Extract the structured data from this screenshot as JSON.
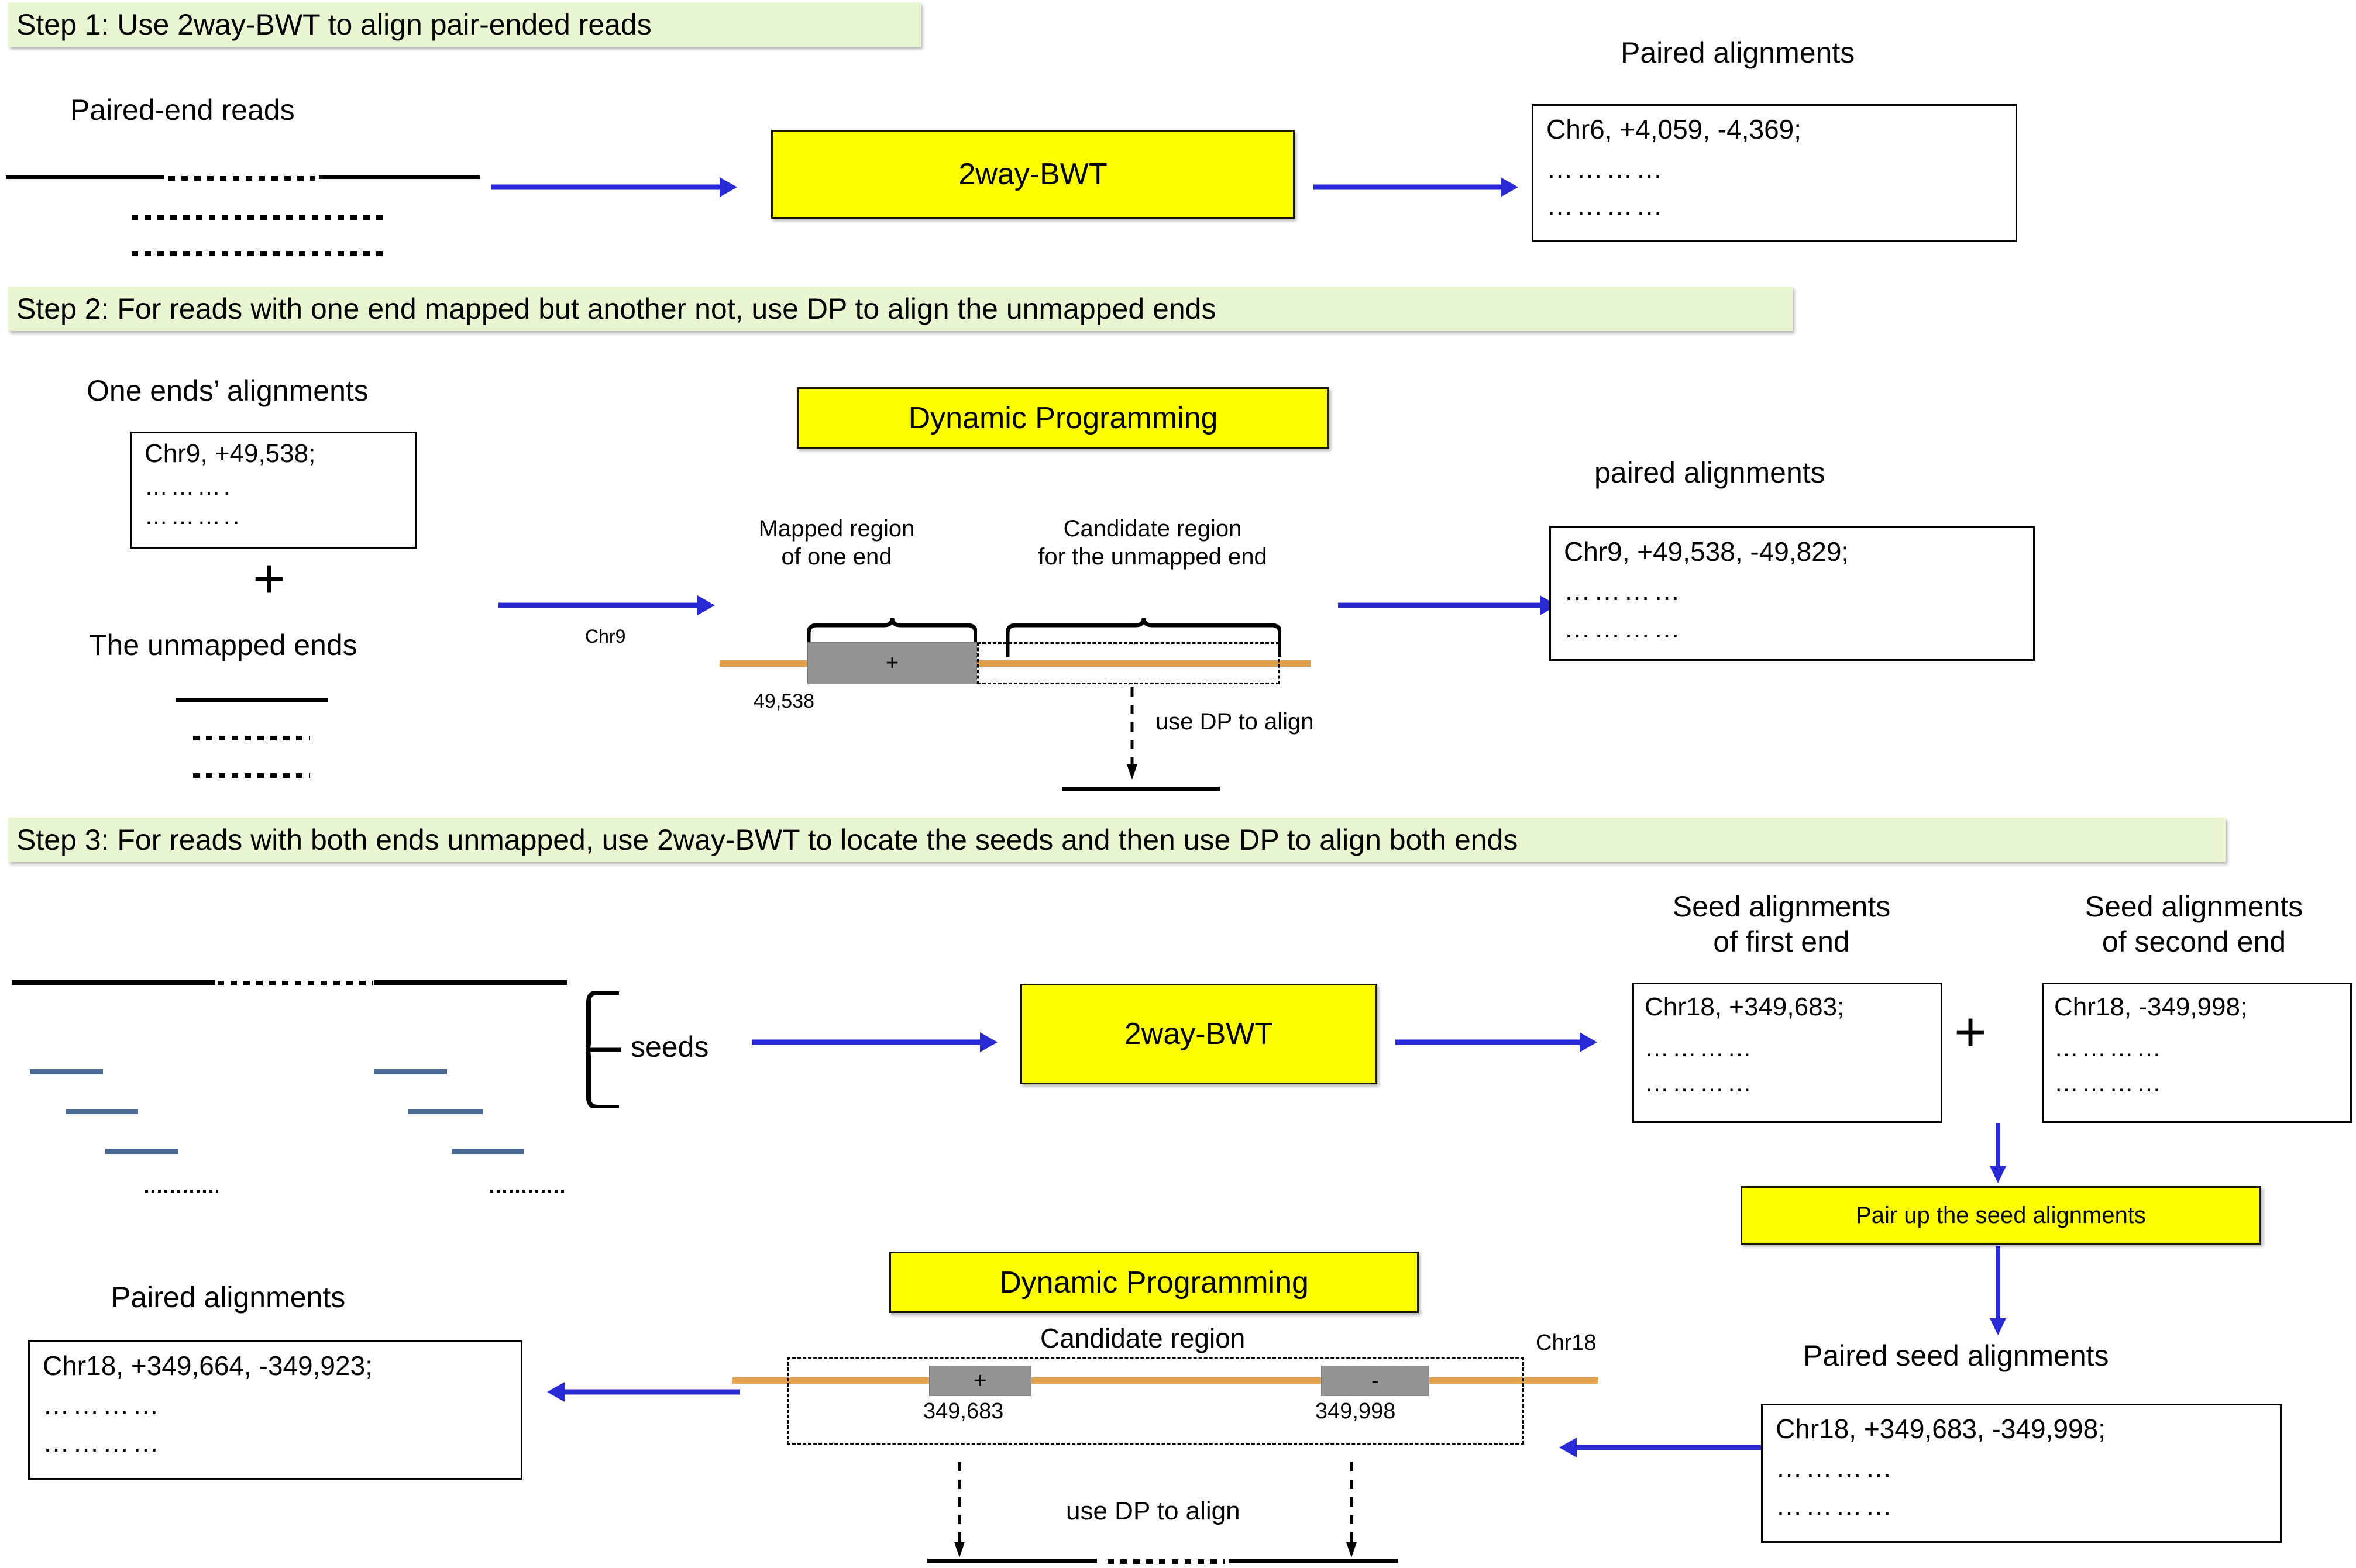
{
  "steps": {
    "step1": {
      "banner": "Step 1: Use 2way-BWT to align pair-ended reads",
      "input_label": "Paired-end reads",
      "process_label": "2way-BWT",
      "output_label": "Paired alignments",
      "output_box": {
        "line1": "Chr6, +4,059, -4,369;",
        "dots1": "…………",
        "dots2": "…………"
      }
    },
    "step2": {
      "banner": "Step 2: For reads with one end mapped but another not, use DP to align the unmapped ends",
      "input_label": "One ends’ alignments",
      "input_box": {
        "line1": "Chr9, +49,538;",
        "dots1": "……….",
        "dots2": "……….."
      },
      "plus": "+",
      "second_input_label": "The unmapped ends",
      "second_input_dots1": "……….",
      "second_input_dots2": "……….",
      "arrow_label": "Chr9",
      "process_label": "Dynamic Programming",
      "mapped_region_label": "Mapped region\nof one end",
      "candidate_region_label": "Candidate region\nfor the unmapped end",
      "mapped_block_sign": "+",
      "mapped_position": "49,538",
      "dp_note": "use DP to align",
      "output_label": "paired alignments",
      "output_box": {
        "line1": "Chr9, +49,538, -49,829;",
        "dots1": "…………",
        "dots2": "…………"
      }
    },
    "step3": {
      "banner": "Step 3: For reads with both ends unmapped, use 2way-BWT to locate the seeds and then use DP to align both ends",
      "seeds_label": "seeds",
      "process_label": "2way-BWT",
      "first_end_label": "Seed alignments\nof first end",
      "first_end_box": {
        "line1": "Chr18, +349,683;",
        "dots1": "…………",
        "dots2": "…………"
      },
      "plus": "+",
      "second_end_label": "Seed alignments\nof second end",
      "second_end_box": {
        "line1": "Chr18, -349,998;",
        "dots1": "…………",
        "dots2": "…………"
      },
      "pair_up_label": "Pair up the seed alignments",
      "paired_seed_label": "Paired seed alignments",
      "paired_seed_box": {
        "line1": "Chr18, +349,683, -349,998;",
        "dots1": "…………",
        "dots2": "…………"
      },
      "dp_process_label": "Dynamic Programming",
      "candidate_region_label": "Candidate region",
      "chromosome_label": "Chr18",
      "left_block_sign": "+",
      "left_block_position": "349,683",
      "right_block_sign": "-",
      "right_block_position": "349,998",
      "dp_note": "use DP to align",
      "output_label": "Paired alignments",
      "output_box": {
        "line1": "Chr18, +349,664, -349,923;",
        "dots1": "…………",
        "dots2": "…………"
      }
    }
  },
  "colors": {
    "banner_green": "#e9f6d2",
    "process_yellow": "#ffff00",
    "arrow_blue": "#2929d6",
    "genome_orange": "#e2a14b",
    "seed_blue": "#4b6a93",
    "block_gray": "#949494"
  }
}
